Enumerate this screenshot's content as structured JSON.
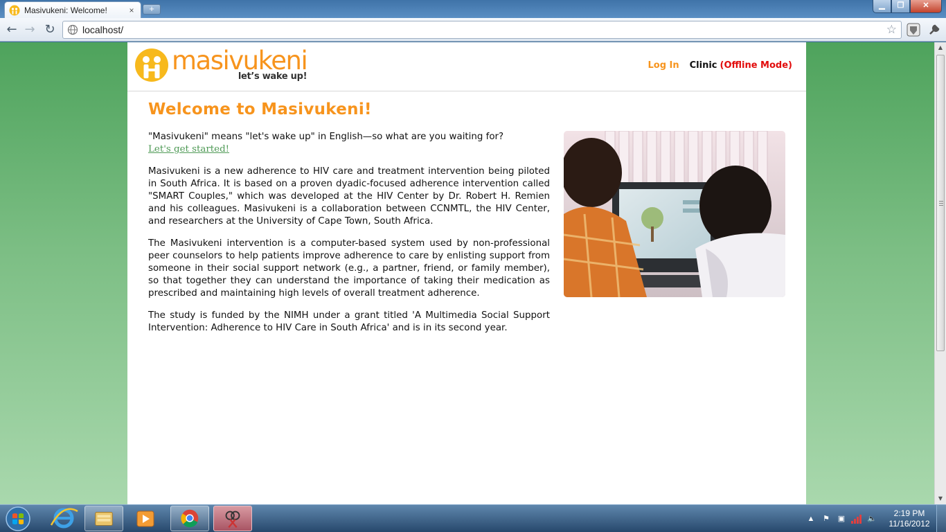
{
  "browser": {
    "tab_title": "Masivukeni: Welcome!",
    "tab_close": "×",
    "new_tab": "+",
    "url": "localhost/",
    "window_buttons": {
      "minimize": "▁",
      "maximize": "❐",
      "close": "✕"
    }
  },
  "site": {
    "logo_name": "masivukeni",
    "logo_tagline": "let’s wake up!",
    "nav": {
      "login": "Log In",
      "clinic": "Clinic",
      "offline": "(Offline Mode)"
    }
  },
  "content": {
    "heading": "Welcome to Masivukeni!",
    "intro": "\"Masivukeni\" means \"let's wake up\" in English—so what are you waiting for?",
    "cta": "Let's get started!",
    "paragraphs": [
      "Masivukeni is a new adherence to HIV care and treatment intervention being piloted in South Africa. It is based on a proven dyadic-focused adherence intervention called \"SMART Couples,\" which was developed at the HIV Center by Dr. Robert H. Remien and his colleagues. Masivukeni is a collaboration between CCNMTL, the HIV Center, and researchers at the University of Cape Town, South Africa.",
      "The Masivukeni intervention is a computer-based system used by non-professional peer counselors to help patients improve adherence to care by enlisting support from someone in their social support network (e.g., a partner, friend, or family member), so that together they can understand the importance of taking their medication as prescribed and maintaining high levels of overall treatment adherence.",
      "The study is funded by the NIMH under a grant titled 'A Multimedia Social Support Intervention: Adherence to HIV Care in South Africa' and is in its second year."
    ]
  },
  "taskbar": {
    "time": "2:19 PM",
    "date": "11/16/2012"
  },
  "colors": {
    "brand_orange": "#f7941d",
    "link_green": "#4f9a56",
    "offline_red": "#e20c0c",
    "background_green": "#4ea35c"
  }
}
